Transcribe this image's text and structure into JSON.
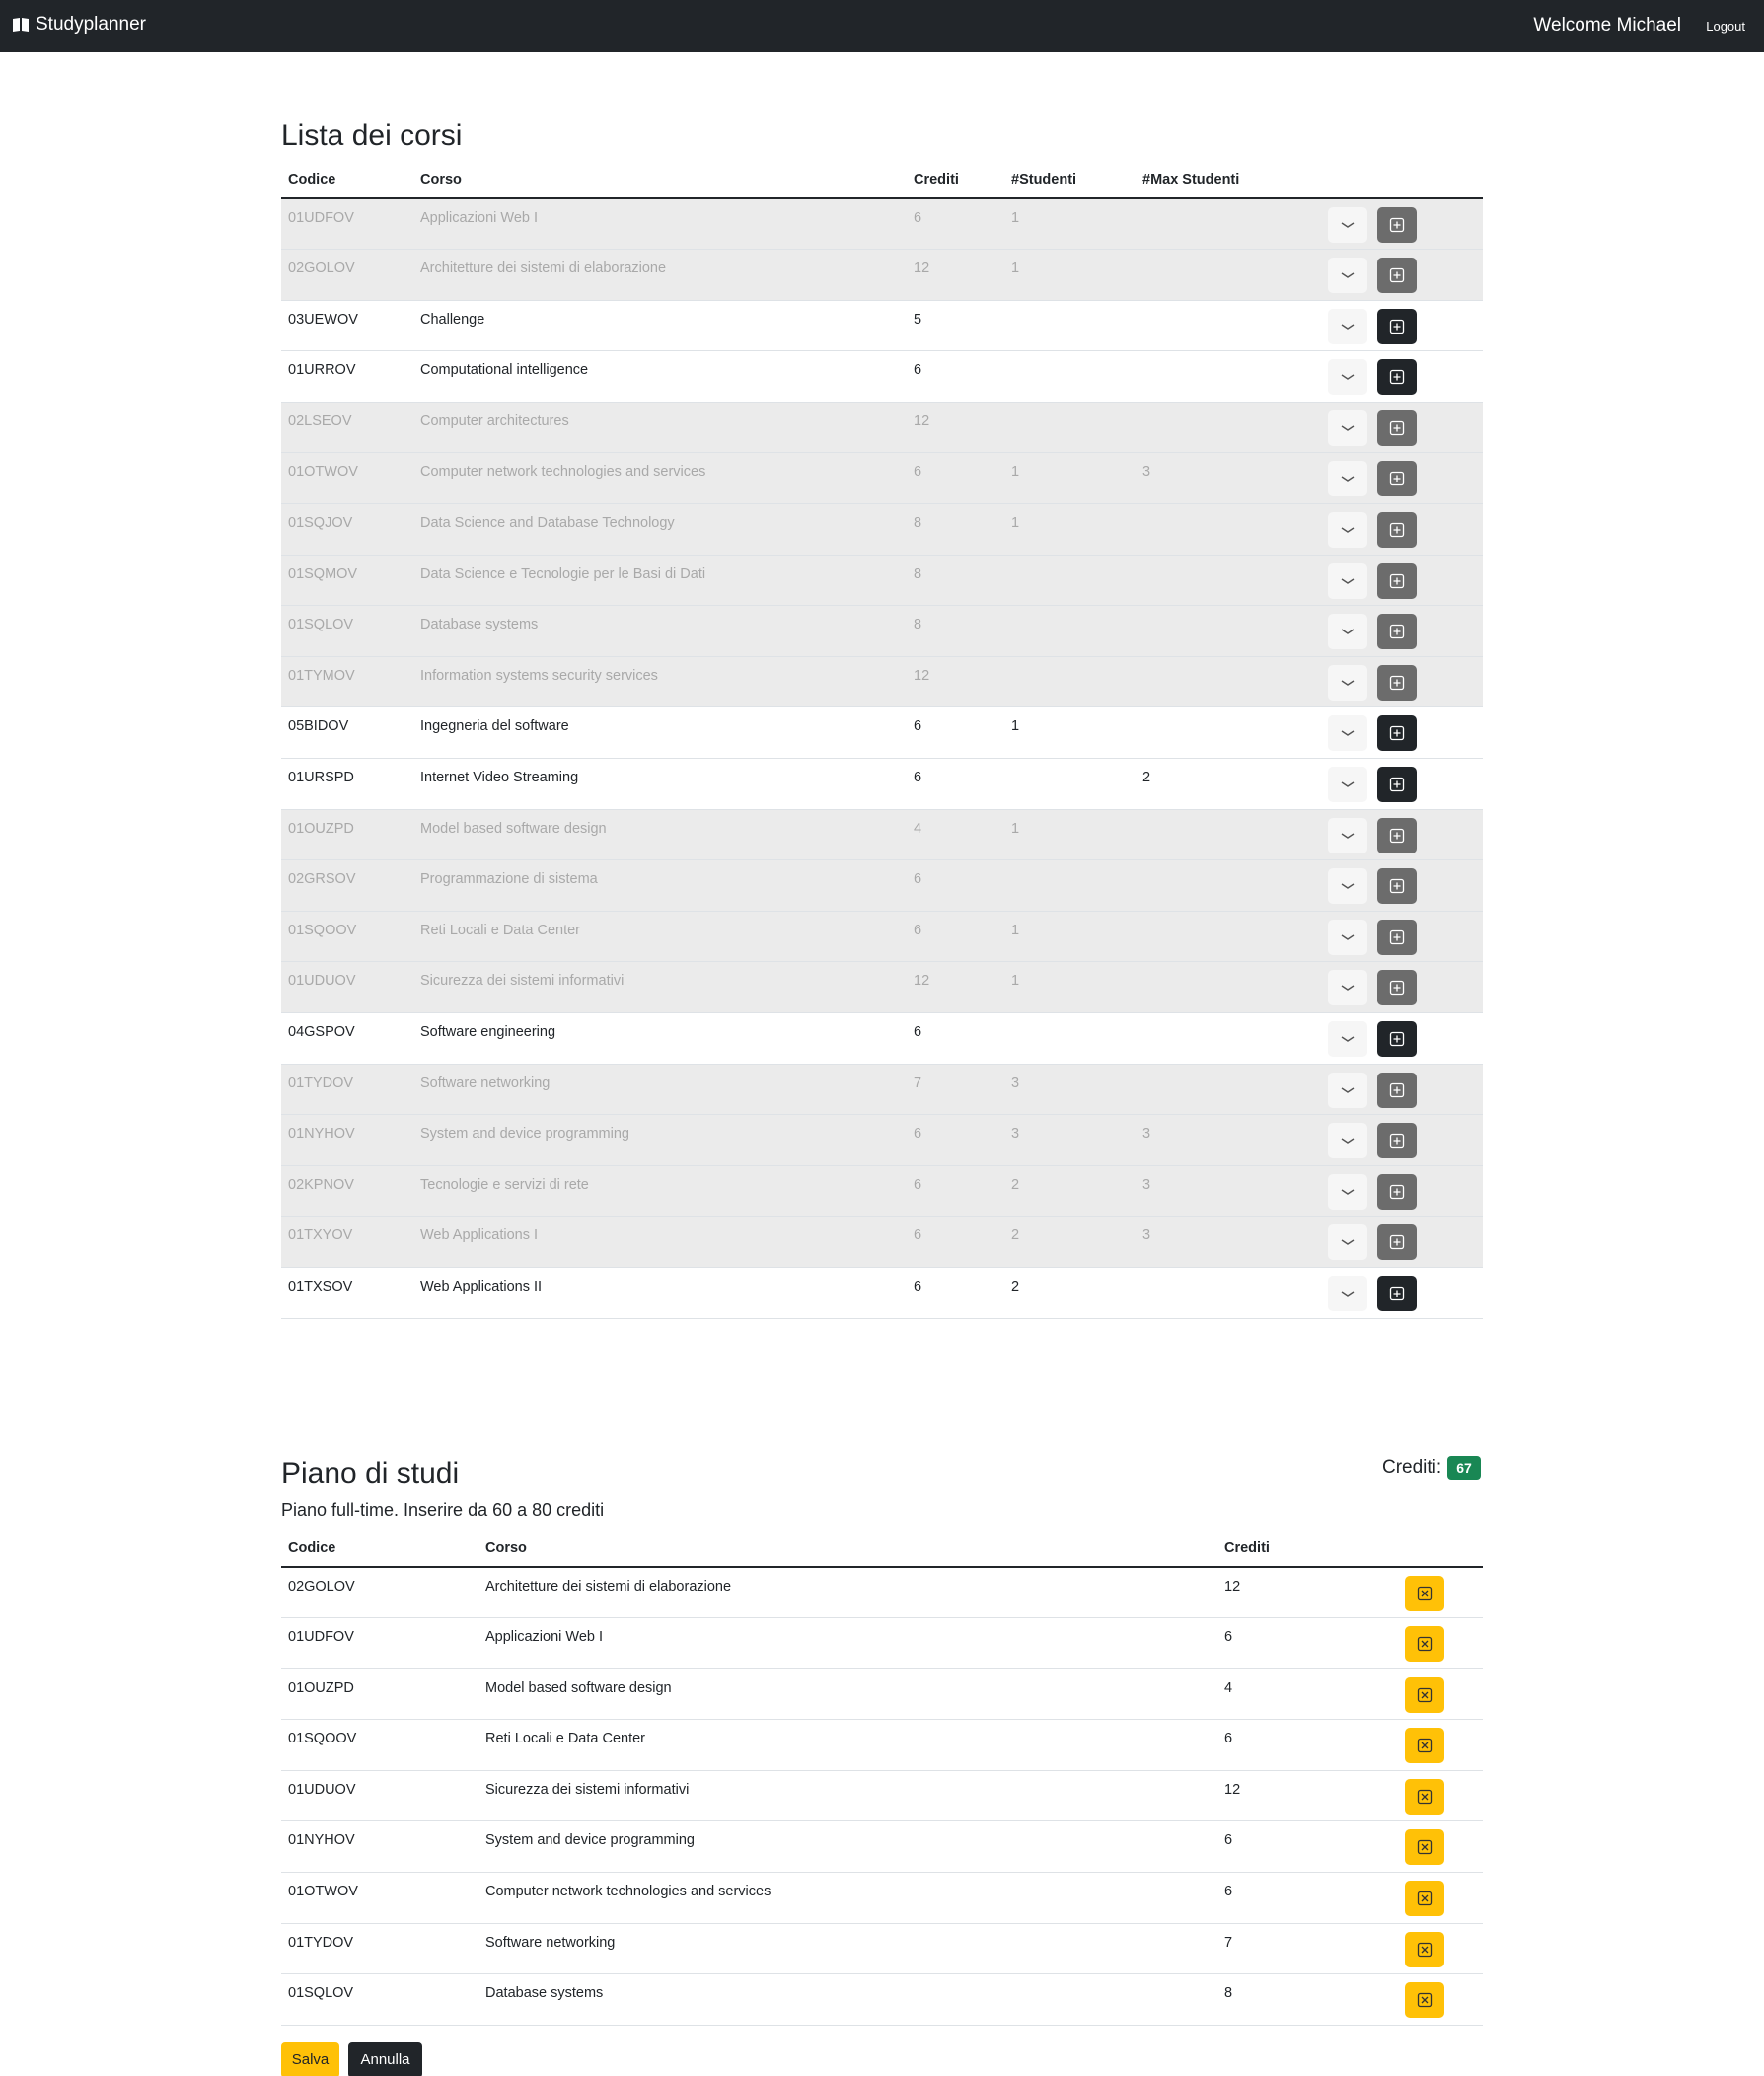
{
  "navbar": {
    "brand": "Studyplanner",
    "welcome": "Welcome Michael",
    "logout": "Logout"
  },
  "courses": {
    "title": "Lista dei corsi",
    "headers": {
      "code": "Codice",
      "name": "Corso",
      "credits": "Crediti",
      "students": "#Studenti",
      "max_students": "#Max Studenti"
    },
    "rows": [
      {
        "code": "01UDFOV",
        "name": "Applicazioni Web I",
        "credits": "6",
        "students": "1",
        "max": "",
        "enabled": false
      },
      {
        "code": "02GOLOV",
        "name": "Architetture dei sistemi di elaborazione",
        "credits": "12",
        "students": "1",
        "max": "",
        "enabled": false
      },
      {
        "code": "03UEWOV",
        "name": "Challenge",
        "credits": "5",
        "students": "",
        "max": "",
        "enabled": true
      },
      {
        "code": "01URROV",
        "name": "Computational intelligence",
        "credits": "6",
        "students": "",
        "max": "",
        "enabled": true
      },
      {
        "code": "02LSEOV",
        "name": "Computer architectures",
        "credits": "12",
        "students": "",
        "max": "",
        "enabled": false
      },
      {
        "code": "01OTWOV",
        "name": "Computer network technologies and services",
        "credits": "6",
        "students": "1",
        "max": "3",
        "enabled": false
      },
      {
        "code": "01SQJOV",
        "name": "Data Science and Database Technology",
        "credits": "8",
        "students": "1",
        "max": "",
        "enabled": false
      },
      {
        "code": "01SQMOV",
        "name": "Data Science e Tecnologie per le Basi di Dati",
        "credits": "8",
        "students": "",
        "max": "",
        "enabled": false
      },
      {
        "code": "01SQLOV",
        "name": "Database systems",
        "credits": "8",
        "students": "",
        "max": "",
        "enabled": false
      },
      {
        "code": "01TYMOV",
        "name": "Information systems security services",
        "credits": "12",
        "students": "",
        "max": "",
        "enabled": false
      },
      {
        "code": "05BIDOV",
        "name": "Ingegneria del software",
        "credits": "6",
        "students": "1",
        "max": "",
        "enabled": true
      },
      {
        "code": "01URSPD",
        "name": "Internet Video Streaming",
        "credits": "6",
        "students": "",
        "max": "2",
        "enabled": true
      },
      {
        "code": "01OUZPD",
        "name": "Model based software design",
        "credits": "4",
        "students": "1",
        "max": "",
        "enabled": false
      },
      {
        "code": "02GRSOV",
        "name": "Programmazione di sistema",
        "credits": "6",
        "students": "",
        "max": "",
        "enabled": false
      },
      {
        "code": "01SQOOV",
        "name": "Reti Locali e Data Center",
        "credits": "6",
        "students": "1",
        "max": "",
        "enabled": false
      },
      {
        "code": "01UDUOV",
        "name": "Sicurezza dei sistemi informativi",
        "credits": "12",
        "students": "1",
        "max": "",
        "enabled": false
      },
      {
        "code": "04GSPOV",
        "name": "Software engineering",
        "credits": "6",
        "students": "",
        "max": "",
        "enabled": true
      },
      {
        "code": "01TYDOV",
        "name": "Software networking",
        "credits": "7",
        "students": "3",
        "max": "",
        "enabled": false
      },
      {
        "code": "01NYHOV",
        "name": "System and device programming",
        "credits": "6",
        "students": "3",
        "max": "3",
        "enabled": false
      },
      {
        "code": "02KPNOV",
        "name": "Tecnologie e servizi di rete",
        "credits": "6",
        "students": "2",
        "max": "3",
        "enabled": false
      },
      {
        "code": "01TXYOV",
        "name": "Web Applications I",
        "credits": "6",
        "students": "2",
        "max": "3",
        "enabled": false
      },
      {
        "code": "01TXSOV",
        "name": "Web Applications II",
        "credits": "6",
        "students": "2",
        "max": "",
        "enabled": true
      }
    ]
  },
  "plan": {
    "title": "Piano di studi",
    "credits_label": "Crediti:",
    "credits_total": "67",
    "subtitle": "Piano full-time. Inserire da 60 a 80 crediti",
    "headers": {
      "code": "Codice",
      "name": "Corso",
      "credits": "Crediti"
    },
    "rows": [
      {
        "code": "02GOLOV",
        "name": "Architetture dei sistemi di elaborazione",
        "credits": "12"
      },
      {
        "code": "01UDFOV",
        "name": "Applicazioni Web I",
        "credits": "6"
      },
      {
        "code": "01OUZPD",
        "name": "Model based software design",
        "credits": "4"
      },
      {
        "code": "01SQOOV",
        "name": "Reti Locali e Data Center",
        "credits": "6"
      },
      {
        "code": "01UDUOV",
        "name": "Sicurezza dei sistemi informativi",
        "credits": "12"
      },
      {
        "code": "01NYHOV",
        "name": "System and device programming",
        "credits": "6"
      },
      {
        "code": "01OTWOV",
        "name": "Computer network technologies and services",
        "credits": "6"
      },
      {
        "code": "01TYDOV",
        "name": "Software networking",
        "credits": "7"
      },
      {
        "code": "01SQLOV",
        "name": "Database systems",
        "credits": "8"
      }
    ],
    "save_label": "Salva",
    "cancel_label": "Annulla"
  },
  "colors": {
    "navbar": "#212529",
    "dim_row": "#ebebeb",
    "add_enabled": "#212529",
    "add_disabled": "#6c6c6c",
    "remove": "#ffc107",
    "credits_badge": "#198754"
  },
  "icons": {
    "brand": "book-icon",
    "expand": "chevron-down-icon",
    "add": "plus-square-icon",
    "remove": "x-square-icon"
  }
}
